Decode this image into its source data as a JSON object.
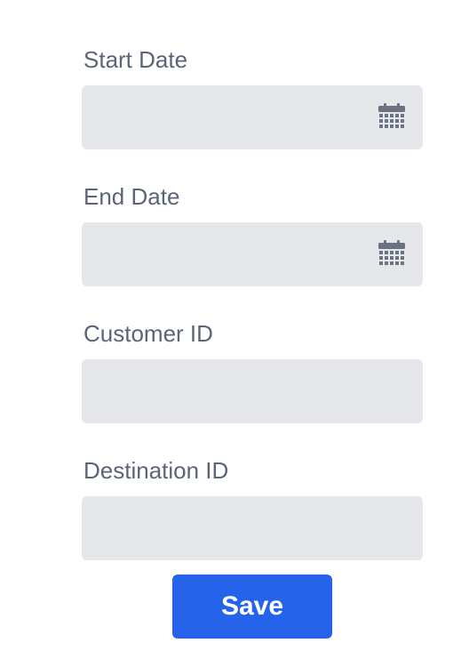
{
  "form": {
    "fields": [
      {
        "label": "Start Date",
        "value": "",
        "icon": "calendar-icon"
      },
      {
        "label": "End Date",
        "value": "",
        "icon": "calendar-icon"
      },
      {
        "label": "Customer ID",
        "value": ""
      },
      {
        "label": "Destination ID",
        "value": ""
      }
    ],
    "save_label": "Save"
  },
  "colors": {
    "accent": "#2563eb",
    "input_bg": "#e5e7eb",
    "label": "#5b6577",
    "icon": "#6b7280"
  }
}
